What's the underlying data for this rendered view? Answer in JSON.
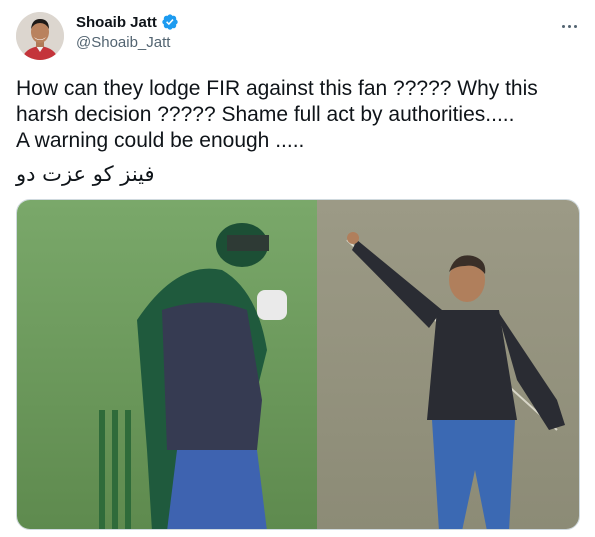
{
  "author": {
    "display_name": "Shoaib Jatt",
    "handle": "@Shoaib_Jatt",
    "verified": true
  },
  "tweet": {
    "text": "How can they lodge FIR against this fan ????? Why this\nharsh decision ????? Shame full act by authorities.....\nA warning could be enough .....",
    "urdu_line": "فینز کو عزت دو"
  },
  "icons": {
    "verified": "verified-badge-icon",
    "more": "more-options-icon"
  },
  "colors": {
    "verified_blue": "#1d9bf0",
    "text_primary": "#0f1419",
    "text_secondary": "#536471"
  }
}
